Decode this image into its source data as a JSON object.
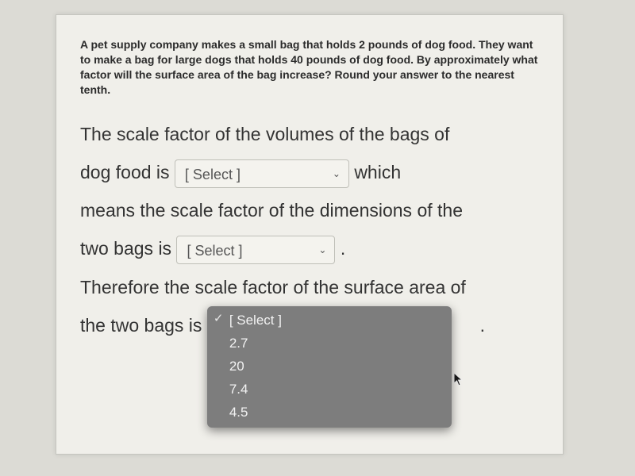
{
  "problem": {
    "prompt": "A pet supply company makes a small bag that holds 2 pounds of dog food. They want to make a bag for large dogs that holds 40 pounds of dog food. By approximately what factor will the surface area of the bag increase? Round your answer to the nearest tenth.",
    "sentence_parts": {
      "p1": "The scale factor of the volumes of the bags of",
      "p2": "dog food is",
      "p3": "which",
      "p4": "means the scale factor of the dimensions of the",
      "p5": "two bags is",
      "p6": "Therefore the scale factor of the surface area of",
      "p7": "the two bags is"
    }
  },
  "selects": {
    "placeholder": "[ Select ]",
    "volume": {
      "value": "[ Select ]"
    },
    "dimension": {
      "value": "[ Select ]"
    },
    "surface": {
      "value": "[ Select ]",
      "open": true,
      "options": [
        "[ Select ]",
        "2.7",
        "20",
        "7.4",
        "4.5"
      ],
      "selected_index": 0
    }
  },
  "punct": {
    "period": "."
  },
  "chart_data": null
}
